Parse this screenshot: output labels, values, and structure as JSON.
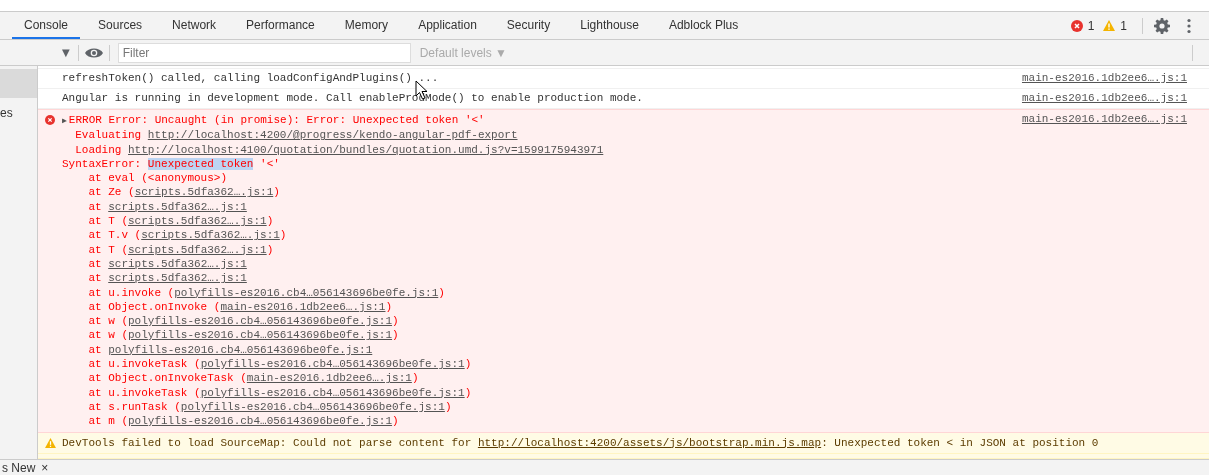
{
  "tabs": [
    {
      "label": "Console",
      "selected": true
    },
    {
      "label": "Sources",
      "selected": false
    },
    {
      "label": "Network",
      "selected": false
    },
    {
      "label": "Performance",
      "selected": false
    },
    {
      "label": "Memory",
      "selected": false
    },
    {
      "label": "Application",
      "selected": false
    },
    {
      "label": "Security",
      "selected": false
    },
    {
      "label": "Lighthouse",
      "selected": false
    },
    {
      "label": "Adblock Plus",
      "selected": false
    }
  ],
  "counts": {
    "errors": "1",
    "warnings": "1"
  },
  "toolbar": {
    "context_caret": "▼",
    "filter": {
      "placeholder": "Filter"
    },
    "levels": "Default levels ▼"
  },
  "sidebar": {
    "items": [
      {
        "selected": true
      },
      {
        "label": "es",
        "selected": false
      }
    ]
  },
  "messages": [
    {
      "kind": "log",
      "lines": [
        [
          {
            "text": "refreshToken() called, calling loadConfigAndPlugins() ..."
          }
        ]
      ],
      "source": "main-es2016.1db2ee6….js:1"
    },
    {
      "kind": "log",
      "lines": [
        [
          {
            "text": "Angular is running in development mode. Call enableProdMode() to enable production mode."
          }
        ]
      ],
      "source": "main-es2016.1db2ee6….js:1"
    },
    {
      "kind": "error",
      "expander": "▶",
      "source": "main-es2016.1db2ee6….js:1",
      "lines": [
        [
          {
            "text": "ERROR Error: Uncaught (in promise): Error: Unexpected token '<'"
          }
        ],
        [
          {
            "text": "  Evaluating "
          },
          {
            "text": "http://localhost:4200/@progress/kendo-angular-pdf-export",
            "link": true
          }
        ],
        [
          {
            "text": "  Loading "
          },
          {
            "text": "http://localhost:4100/quotation/bundles/quotation.umd.js?v=1599175943971",
            "link": true
          }
        ],
        [
          {
            "text": "SyntaxError: "
          },
          {
            "text": "Unexpected token",
            "highlighted": true
          },
          {
            "text": " '<'"
          }
        ],
        [
          {
            "text": "    at eval (<anonymous>)"
          }
        ],
        [
          {
            "text": "    at Ze ("
          },
          {
            "text": "scripts.5dfa362….js:1",
            "link": true
          },
          {
            "text": ")"
          }
        ],
        [
          {
            "text": "    at "
          },
          {
            "text": "scripts.5dfa362….js:1",
            "link": true
          }
        ],
        [
          {
            "text": "    at T ("
          },
          {
            "text": "scripts.5dfa362….js:1",
            "link": true
          },
          {
            "text": ")"
          }
        ],
        [
          {
            "text": "    at T.v ("
          },
          {
            "text": "scripts.5dfa362….js:1",
            "link": true
          },
          {
            "text": ")"
          }
        ],
        [
          {
            "text": "    at T ("
          },
          {
            "text": "scripts.5dfa362….js:1",
            "link": true
          },
          {
            "text": ")"
          }
        ],
        [
          {
            "text": "    at "
          },
          {
            "text": "scripts.5dfa362….js:1",
            "link": true
          }
        ],
        [
          {
            "text": "    at "
          },
          {
            "text": "scripts.5dfa362….js:1",
            "link": true
          }
        ],
        [
          {
            "text": "    at u.invoke ("
          },
          {
            "text": "polyfills-es2016.cb4…056143696be0fe.js:1",
            "link": true
          },
          {
            "text": ")"
          }
        ],
        [
          {
            "text": "    at Object.onInvoke ("
          },
          {
            "text": "main-es2016.1db2ee6….js:1",
            "link": true
          },
          {
            "text": ")"
          }
        ],
        [
          {
            "text": "    at w ("
          },
          {
            "text": "polyfills-es2016.cb4…056143696be0fe.js:1",
            "link": true
          },
          {
            "text": ")"
          }
        ],
        [
          {
            "text": "    at w ("
          },
          {
            "text": "polyfills-es2016.cb4…056143696be0fe.js:1",
            "link": true
          },
          {
            "text": ")"
          }
        ],
        [
          {
            "text": "    at "
          },
          {
            "text": "polyfills-es2016.cb4…056143696be0fe.js:1",
            "link": true
          }
        ],
        [
          {
            "text": "    at u.invokeTask ("
          },
          {
            "text": "polyfills-es2016.cb4…056143696be0fe.js:1",
            "link": true
          },
          {
            "text": ")"
          }
        ],
        [
          {
            "text": "    at Object.onInvokeTask ("
          },
          {
            "text": "main-es2016.1db2ee6….js:1",
            "link": true
          },
          {
            "text": ")"
          }
        ],
        [
          {
            "text": "    at u.invokeTask ("
          },
          {
            "text": "polyfills-es2016.cb4…056143696be0fe.js:1",
            "link": true
          },
          {
            "text": ")"
          }
        ],
        [
          {
            "text": "    at s.runTask ("
          },
          {
            "text": "polyfills-es2016.cb4…056143696be0fe.js:1",
            "link": true
          },
          {
            "text": ")"
          }
        ],
        [
          {
            "text": "    at m ("
          },
          {
            "text": "polyfills-es2016.cb4…056143696be0fe.js:1",
            "link": true
          },
          {
            "text": ")"
          }
        ]
      ]
    },
    {
      "kind": "warning",
      "lines": [
        [
          {
            "text": "DevTools failed to load SourceMap: Could not parse content for "
          },
          {
            "text": "http://localhost:4200/assets/js/bootstrap.min.js.map",
            "link": true
          },
          {
            "text": ": Unexpected token < in JSON at position 0"
          }
        ]
      ]
    }
  ],
  "drawer": {
    "tab": "s New",
    "close": "×"
  }
}
